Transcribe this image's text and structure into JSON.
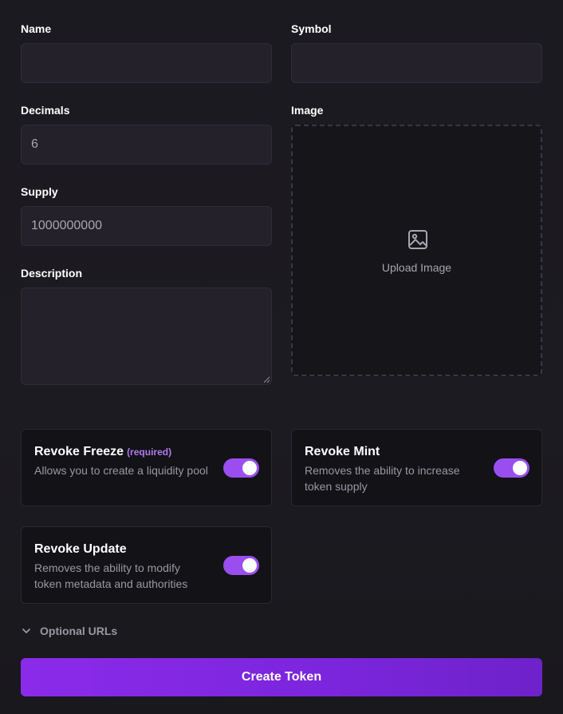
{
  "form": {
    "name": {
      "label": "Name",
      "value": ""
    },
    "symbol": {
      "label": "Symbol",
      "value": ""
    },
    "decimals": {
      "label": "Decimals",
      "placeholder": "6"
    },
    "supply": {
      "label": "Supply",
      "placeholder": "1000000000"
    },
    "description": {
      "label": "Description",
      "value": ""
    },
    "image": {
      "label": "Image",
      "upload_text": "Upload Image",
      "icon": "image-icon"
    }
  },
  "options": [
    {
      "title": "Revoke Freeze",
      "tag": "(required)",
      "description": "Allows you to create a liquidity pool",
      "enabled": true
    },
    {
      "title": "Revoke Mint",
      "description": "Removes the ability to increase token supply",
      "enabled": true
    },
    {
      "title": "Revoke Update",
      "description": "Removes the ability to modify token metadata and authorities",
      "enabled": true
    }
  ],
  "optional_urls": {
    "label": "Optional URLs",
    "icon": "chevron-down-icon",
    "expanded": false
  },
  "submit": {
    "label": "Create Token"
  },
  "colors": {
    "accent": "#9a4ef0",
    "required_tag": "#b07cf0",
    "button_gradient_start": "#8b2bea",
    "button_gradient_end": "#6e22c9",
    "background": "#1b1a20"
  }
}
